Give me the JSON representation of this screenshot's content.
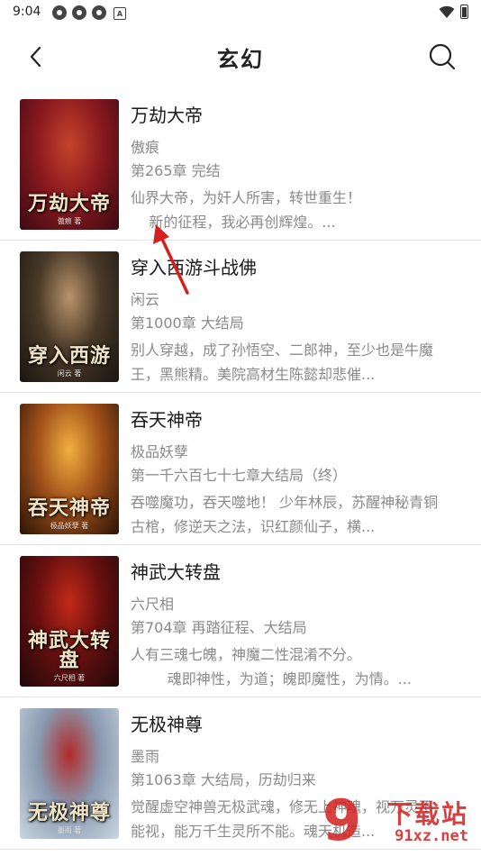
{
  "status_bar": {
    "time": "9:04",
    "notif_letter": "A"
  },
  "header": {
    "title": "玄幻",
    "back_icon": "chevron-left-icon",
    "search_icon": "search-icon"
  },
  "books": [
    {
      "title": "万劫大帝",
      "author": "傲痕",
      "chapter": "第265章 完结",
      "description": "仙界大帝，为奸人所害，转世重生！\n    新的征程，我必再创辉煌。...",
      "cover_text": "万劫大帝",
      "cover_author": "傲痕 著",
      "cover_colors": [
        "#3a0a12",
        "#8c1a1f",
        "#c4442a"
      ]
    },
    {
      "title": "穿入西游斗战佛",
      "author": "闲云",
      "chapter": "第1000章 大结局",
      "description": "别人穿越，成了孙悟空、二郎神，至少也是牛魔王，黑熊精。美院高材生陈懿却悲催...",
      "cover_text": "穿入西游",
      "cover_author": "闲云 著",
      "cover_colors": [
        "#1a1410",
        "#4a3a28",
        "#b8936a"
      ]
    },
    {
      "title": "吞天神帝",
      "author": "极品妖孽",
      "chapter": "第一千六百七十七章大结局（终）",
      "description": "吞噬魔功，吞天噬地！ 少年林辰，苏醒神秘青铜古棺，修逆天之法，识红颜仙子，横...",
      "cover_text": "吞天神帝",
      "cover_author": "极品妖孽 著",
      "cover_colors": [
        "#2a1206",
        "#a4531a",
        "#f0b040"
      ]
    },
    {
      "title": "神武大转盘",
      "author": "六尺相",
      "chapter": "第704章 再踏征程、大结局",
      "description": "人有三魂七魄，神魔二性混淆不分。\n        魂即神性，为道；魄即魔性，为情。...",
      "cover_text": "神武大转盘",
      "cover_author": "六尺相 著",
      "cover_colors": [
        "#1e0808",
        "#6a1010",
        "#c22a18"
      ]
    },
    {
      "title": "无极神尊",
      "author": "墨雨",
      "chapter": "第1063章 大结局，历劫归来",
      "description": "觉醒虚空神兽无极武魂，修无上神魂，视万灵不能视，能万千生灵所不能。魂天机造...",
      "cover_text": "无极神尊",
      "cover_author": "墨雨 著",
      "cover_colors": [
        "#c9d6e0",
        "#8a9ab0",
        "#b02a2a"
      ]
    }
  ],
  "watermark": {
    "num": "9",
    "text": "下载站",
    "url": "91xz.net"
  }
}
